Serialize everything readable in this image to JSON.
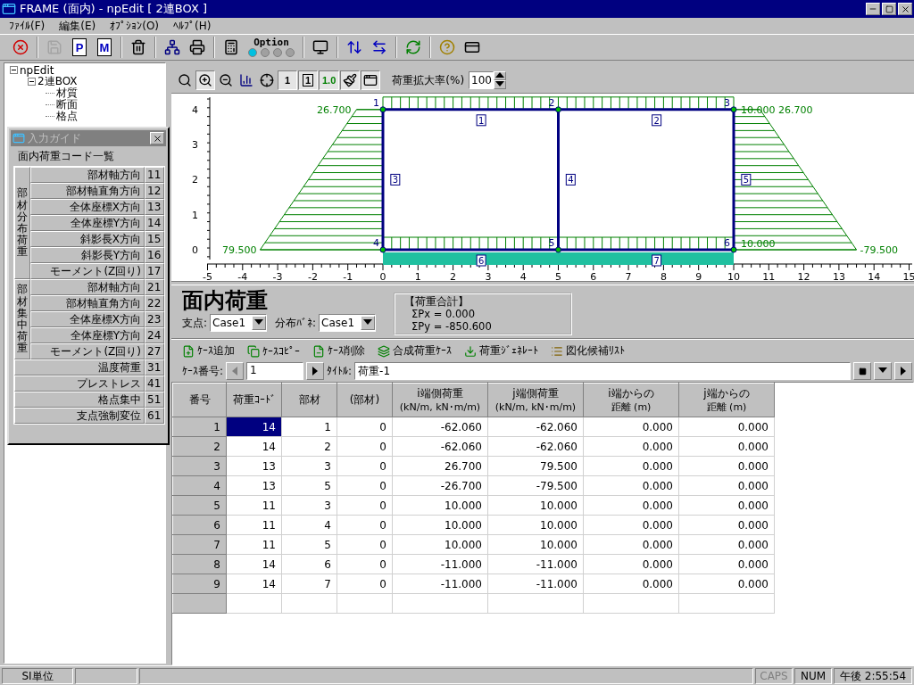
{
  "window": {
    "title": "FRAME (面内) - npEdit [ 2連BOX ]"
  },
  "menu": [
    "ﾌｧｲﾙ(F)",
    "編集(E)",
    "ｵﾌﾟｼｮﾝ(O)",
    "ﾍﾙﾌﾟ(H)"
  ],
  "toolbar": [
    {
      "kind": "stop",
      "disabled": false
    },
    {
      "kind": "save",
      "disabled": true
    },
    {
      "kind": "doc",
      "glyph": "P",
      "disabled": false
    },
    {
      "kind": "doc",
      "glyph": "M",
      "disabled": false
    },
    {
      "kind": "trash",
      "disabled": false
    },
    {
      "kind": "network",
      "disabled": false
    },
    {
      "kind": "print",
      "disabled": false
    },
    {
      "kind": "calculator",
      "disabled": false
    },
    {
      "kind": "option",
      "label": "Option",
      "disabled": false,
      "choices": [
        {
          "selected": true
        },
        {
          "selected": false
        },
        {
          "selected": false
        },
        {
          "selected": false
        }
      ]
    },
    {
      "kind": "monitor",
      "disabled": false
    },
    {
      "kind": "vsplit",
      "disabled": false
    },
    {
      "kind": "hsplit",
      "disabled": false
    },
    {
      "kind": "refresh",
      "disabled": false
    },
    {
      "kind": "help",
      "disabled": false
    },
    {
      "kind": "card",
      "disabled": false
    }
  ],
  "tree": [
    {
      "label": "npEdit",
      "expanded": true,
      "children": [
        {
          "label": "2連BOX",
          "expanded": true,
          "children": [
            {
              "label": "材質"
            },
            {
              "label": "断面"
            },
            {
              "label": "格点"
            }
          ]
        }
      ]
    }
  ],
  "guide": {
    "title": "入力ガイド",
    "heading": "面内荷重コード一覧",
    "codes": [
      {
        "kind": "group",
        "label": "部材分布荷重",
        "items": [
          {
            "name": "部材軸方向",
            "code": "11"
          },
          {
            "name": "部材軸直角方向",
            "code": "12"
          },
          {
            "name": "全体座標X方向",
            "code": "13"
          },
          {
            "name": "全体座標Y方向",
            "code": "14"
          },
          {
            "name": "斜影長X方向",
            "code": "15"
          },
          {
            "name": "斜影長Y方向",
            "code": "16"
          },
          {
            "name": "モーメント(Z回り)",
            "code": "17"
          }
        ]
      },
      {
        "kind": "group",
        "label": "部材集中荷重",
        "items": [
          {
            "name": "部材軸方向",
            "code": "21"
          },
          {
            "name": "部材軸直角方向",
            "code": "22"
          },
          {
            "name": "全体座標X方向",
            "code": "23"
          },
          {
            "name": "全体座標Y方向",
            "code": "24"
          },
          {
            "name": "モーメント(Z回り)",
            "code": "27"
          }
        ]
      },
      {
        "kind": "single",
        "name": "温度荷重",
        "code": "31"
      },
      {
        "kind": "single",
        "name": "プレストレス",
        "code": "41"
      },
      {
        "kind": "single",
        "name": "格点集中",
        "code": "51"
      },
      {
        "kind": "single",
        "name": "支点強制変位",
        "code": "61"
      }
    ]
  },
  "chart_toolbar": {
    "tools": [
      {
        "kind": "zoom_fit",
        "pressed": false
      },
      {
        "kind": "zoom_in",
        "pressed": true
      },
      {
        "kind": "zoom_out",
        "pressed": false
      },
      {
        "kind": "style",
        "pressed": false
      },
      {
        "kind": "cursor",
        "pressed": false
      },
      {
        "kind": "node_number",
        "glyph": "1",
        "pressed": true
      },
      {
        "kind": "member_number",
        "glyph": "1",
        "pressed": true
      },
      {
        "kind": "load_value",
        "glyph": "1.0",
        "pressed": true
      },
      {
        "kind": "paint",
        "pressed": true
      },
      {
        "kind": "window",
        "pressed": true
      }
    ],
    "scale_label": "荷重拡大率(%)",
    "scale_value": "100"
  },
  "diagram": {
    "x_ticks": [
      "-5",
      "-4",
      "-3",
      "-2",
      "-1",
      "0",
      "1",
      "2",
      "3",
      "4",
      "5",
      "6",
      "7",
      "8",
      "9",
      "10",
      "11",
      "12",
      "13",
      "14",
      "15"
    ],
    "y_ticks": [
      "4",
      "3",
      "2",
      "1",
      "0"
    ],
    "nodes": [
      "1",
      "2",
      "3",
      "4",
      "5",
      "6"
    ],
    "members": [
      "1",
      "2",
      "3",
      "4",
      "5",
      "6",
      "7"
    ],
    "load_labels": [
      "26.700",
      "10.000",
      "26.700",
      "79.500",
      "10.000",
      "-79.500"
    ]
  },
  "load_panel": {
    "title": "面内荷重",
    "support_label": "支点:",
    "support_value": "Case1",
    "spring_label": "分布ﾊﾞﾈ:",
    "spring_value": "Case1",
    "totals": [
      "【荷重合計】",
      "ΣPx = 0.000",
      "ΣPy = -850.600"
    ]
  },
  "actions": [
    {
      "kind": "add",
      "label": "ｹｰｽ追加"
    },
    {
      "kind": "copy",
      "label": "ｹｰｽｺﾋﾟｰ"
    },
    {
      "kind": "delete",
      "label": "ｹｰｽ削除"
    },
    {
      "kind": "combine",
      "label": "合成荷重ｹｰｽ"
    },
    {
      "kind": "generate",
      "label": "荷重ｼﾞｪﾈﾚｰﾄ"
    },
    {
      "kind": "list",
      "label": "図化候補ﾘｽﾄ"
    }
  ],
  "case_bar": {
    "number_label": "ｹｰｽ番号:",
    "number_value": "1",
    "prev": {
      "disabled": true
    },
    "next": {
      "disabled": false
    },
    "title_label": "ﾀｲﾄﾙ:",
    "title_value": "荷重-1"
  },
  "table": {
    "columns": [
      {
        "lines": [
          "番号"
        ]
      },
      {
        "lines": [
          "荷重ｺｰﾄﾞ"
        ]
      },
      {
        "lines": [
          "部材"
        ]
      },
      {
        "lines": [
          "(部材)"
        ]
      },
      {
        "lines": [
          "i端側荷重",
          "(kN/m, kN･m/m)"
        ]
      },
      {
        "lines": [
          "j端側荷重",
          "(kN/m, kN･m/m)"
        ]
      },
      {
        "lines": [
          "i端からの",
          "距離 (m)"
        ]
      },
      {
        "lines": [
          "j端からの",
          "距離 (m)"
        ]
      }
    ],
    "rows": [
      {
        "selected": true,
        "cells": [
          "1",
          "14",
          "1",
          "0",
          "-62.060",
          "-62.060",
          "0.000",
          "0.000"
        ]
      },
      {
        "selected": false,
        "cells": [
          "2",
          "14",
          "2",
          "0",
          "-62.060",
          "-62.060",
          "0.000",
          "0.000"
        ]
      },
      {
        "selected": false,
        "cells": [
          "3",
          "13",
          "3",
          "0",
          "26.700",
          "79.500",
          "0.000",
          "0.000"
        ]
      },
      {
        "selected": false,
        "cells": [
          "4",
          "13",
          "5",
          "0",
          "-26.700",
          "-79.500",
          "0.000",
          "0.000"
        ]
      },
      {
        "selected": false,
        "cells": [
          "5",
          "11",
          "3",
          "0",
          "10.000",
          "10.000",
          "0.000",
          "0.000"
        ]
      },
      {
        "selected": false,
        "cells": [
          "6",
          "11",
          "4",
          "0",
          "10.000",
          "10.000",
          "0.000",
          "0.000"
        ]
      },
      {
        "selected": false,
        "cells": [
          "7",
          "11",
          "5",
          "0",
          "10.000",
          "10.000",
          "0.000",
          "0.000"
        ]
      },
      {
        "selected": false,
        "cells": [
          "8",
          "14",
          "6",
          "0",
          "-11.000",
          "-11.000",
          "0.000",
          "0.000"
        ]
      },
      {
        "selected": false,
        "cells": [
          "9",
          "14",
          "7",
          "0",
          "-11.000",
          "-11.000",
          "0.000",
          "0.000"
        ]
      }
    ]
  },
  "status_bar": {
    "left": "SI単位",
    "indicators": [
      {
        "text": "CAPS",
        "disabled": true
      },
      {
        "text": "NUM",
        "disabled": false
      }
    ],
    "clock": "午後 2:55:54"
  }
}
